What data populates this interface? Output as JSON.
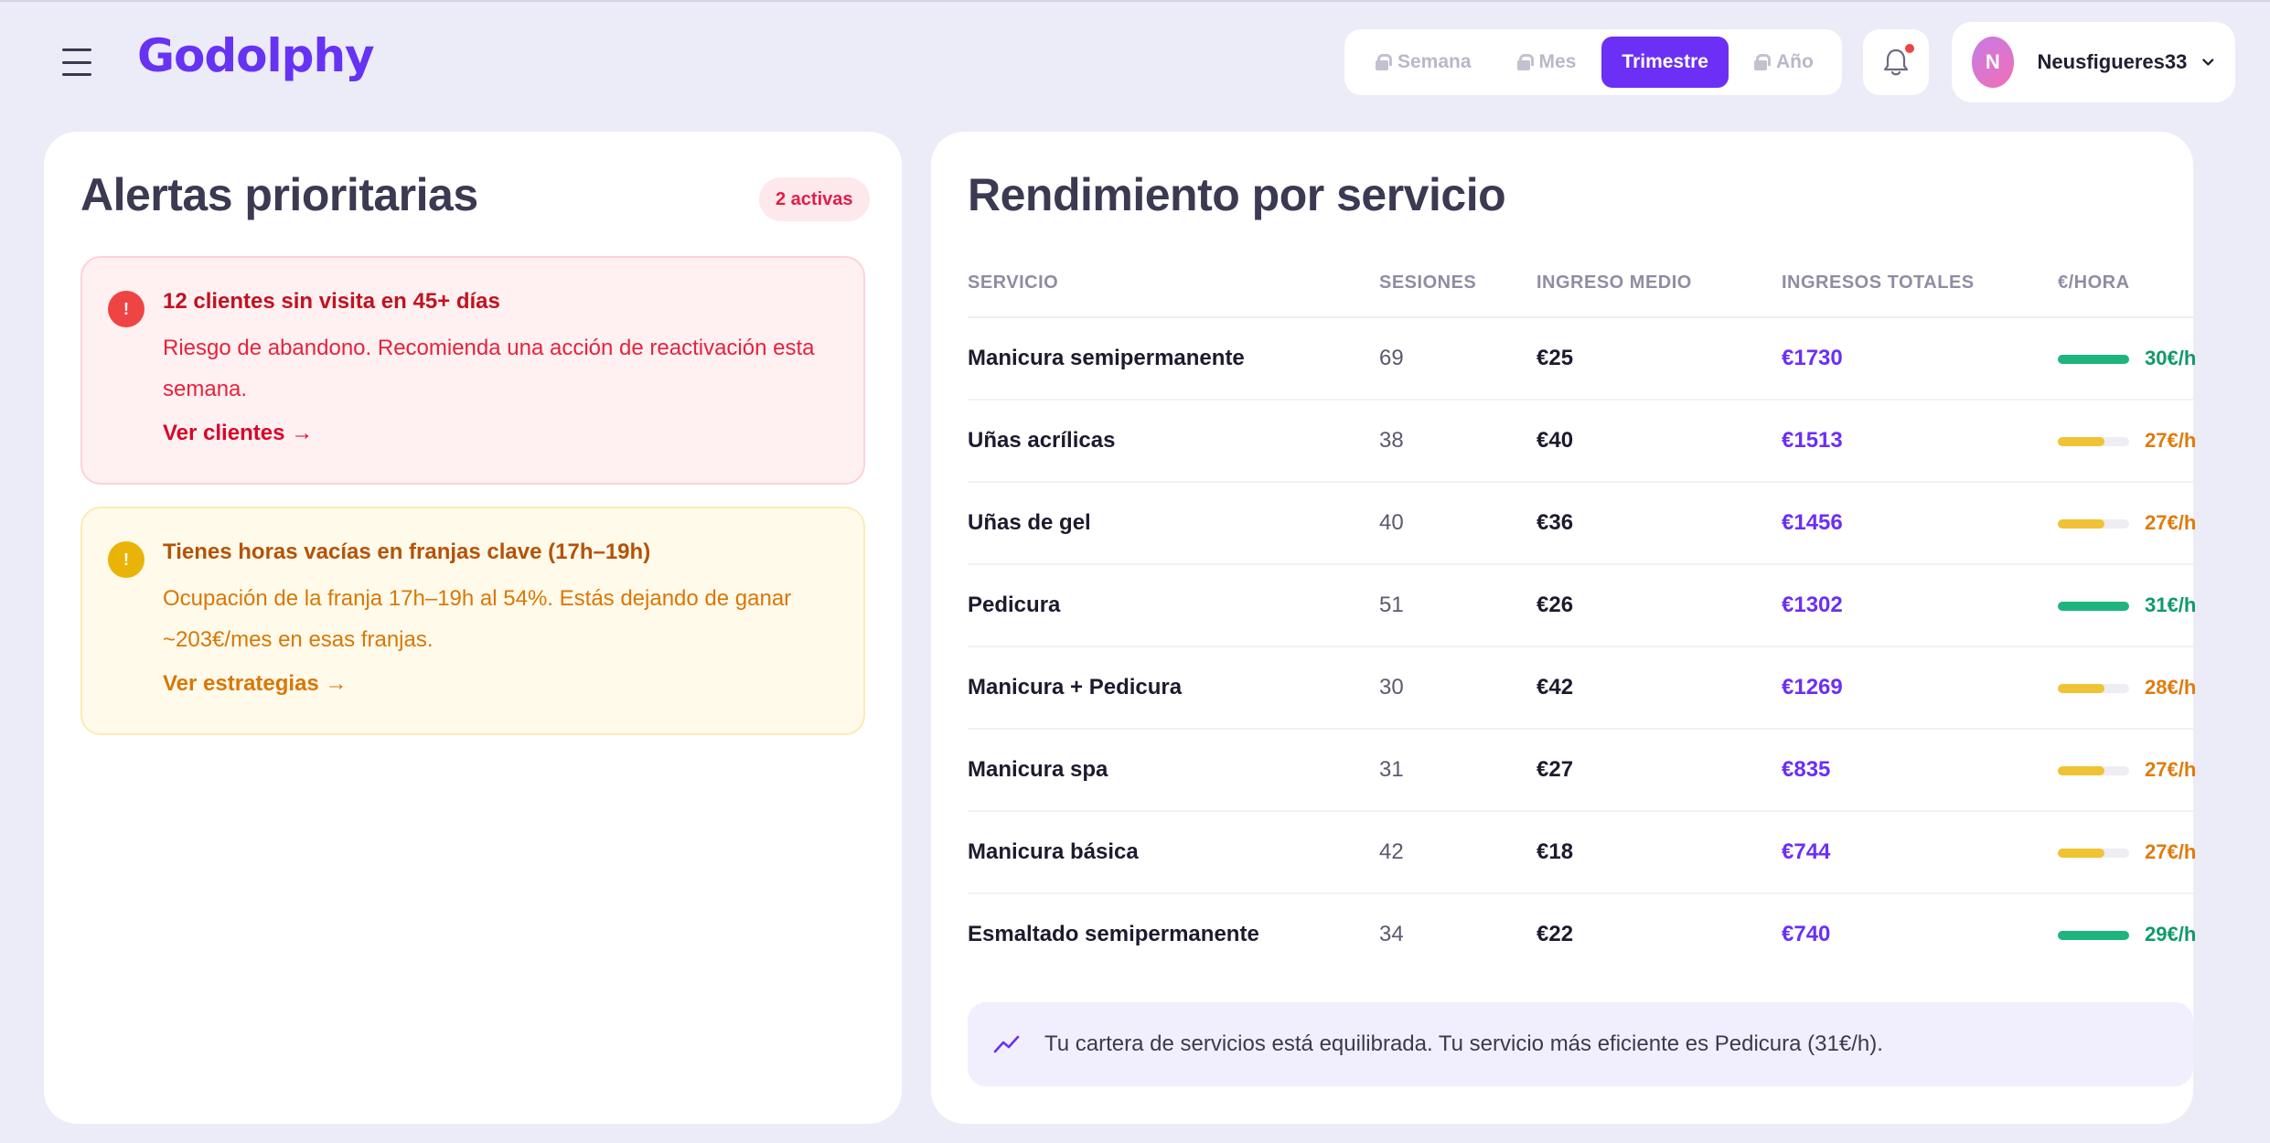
{
  "header": {
    "logo_text": "Godolphy",
    "period_options": [
      "Semana",
      "Mes",
      "Trimestre",
      "Año"
    ],
    "period_selected": "Trimestre",
    "user": {
      "initial": "N",
      "name": "Neusfigueres33"
    },
    "has_notifications": true
  },
  "alerts_card": {
    "title": "Alertas prioritarias",
    "badge": "2 activas",
    "alerts": [
      {
        "icon": "!",
        "severity": "red",
        "title": "12 clientes sin visita en 45+ días",
        "text": "Riesgo de abandono. Recomienda una acción de reactivación esta semana.",
        "link": "Ver clientes →"
      },
      {
        "icon": "!",
        "severity": "yellow",
        "title": "Tienes horas vacías en franjas clave (17h–19h)",
        "text": "Ocupación de la franja 17h–19h al 54%. Estás dejando de ganar ~203€/mes en esas franjas.",
        "link": "Ver estrategias →"
      }
    ]
  },
  "performance_card": {
    "title": "Rendimiento por servicio",
    "columns": [
      "SERVICIO",
      "SESIONES",
      "INGRESO MEDIO",
      "INGRESOS TOTALES",
      "€/HORA"
    ],
    "rows": [
      {
        "service": "Manicura semipermanente",
        "sessions": "69",
        "avg": "€25",
        "total": "€1730",
        "rate": "30€/h",
        "level": 1.0,
        "status": "green"
      },
      {
        "service": "Uñas acrílicas",
        "sessions": "38",
        "avg": "€40",
        "total": "€1513",
        "rate": "27€/h",
        "level": 0.65,
        "status": "yellow"
      },
      {
        "service": "Uñas de gel",
        "sessions": "40",
        "avg": "€36",
        "total": "€1456",
        "rate": "27€/h",
        "level": 0.65,
        "status": "yellow"
      },
      {
        "service": "Pedicura",
        "sessions": "51",
        "avg": "€26",
        "total": "€1302",
        "rate": "31€/h",
        "level": 1.0,
        "status": "green"
      },
      {
        "service": "Manicura + Pedicura",
        "sessions": "30",
        "avg": "€42",
        "total": "€1269",
        "rate": "28€/h",
        "level": 0.65,
        "status": "yellow"
      },
      {
        "service": "Manicura spa",
        "sessions": "31",
        "avg": "€27",
        "total": "€835",
        "rate": "27€/h",
        "level": 0.65,
        "status": "yellow"
      },
      {
        "service": "Manicura básica",
        "sessions": "42",
        "avg": "€18",
        "total": "€744",
        "rate": "27€/h",
        "level": 0.65,
        "status": "yellow"
      },
      {
        "service": "Esmaltado semipermanente",
        "sessions": "34",
        "avg": "€22",
        "total": "€740",
        "rate": "29€/h",
        "level": 1.0,
        "status": "green"
      }
    ],
    "insight": "Tu cartera de servicios está equilibrada. Tu servicio más eficiente es Pedicura (31€/h)."
  },
  "colors": {
    "accent": "#6b2ff5",
    "green": "#1fb47e",
    "green_text": "#0f9a68",
    "yellow": "#efc334",
    "yellow_text": "#e07b0c",
    "red": "#ef4444"
  }
}
